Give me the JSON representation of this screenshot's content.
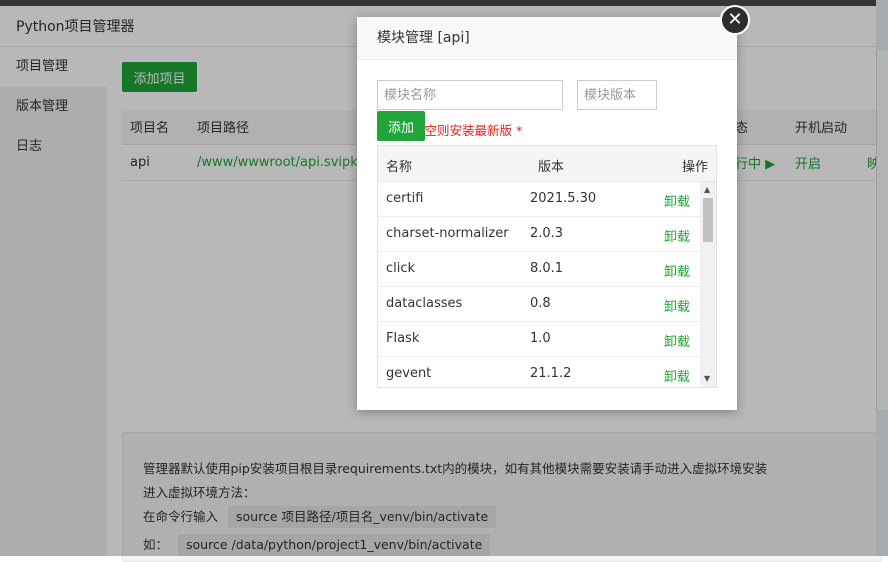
{
  "app": {
    "title": "Python项目管理器"
  },
  "sidebar": {
    "items": [
      {
        "label": "项目管理"
      },
      {
        "label": "版本管理"
      },
      {
        "label": "日志"
      }
    ]
  },
  "toolbar": {
    "add_project": "添加项目"
  },
  "project_table": {
    "headers": [
      "项目名",
      "项目路径",
      "",
      "态",
      "开机启动",
      ""
    ],
    "rows": [
      {
        "name": "api",
        "path": "/www/wwwroot/api.svipki",
        "status": "行中 ▶",
        "autostart": "开启",
        "extra": "映"
      }
    ]
  },
  "info": {
    "line1": "管理器默认使用pip安装项目根目录requirements.txt内的模块，如有其他模块需要安装请手动进入虚拟环境安装",
    "line2": "进入虚拟环境方法：",
    "line3_label": "在命令行输入",
    "line3_code": "source 项目路径/项目名_venv/bin/activate",
    "line4_label": "如：",
    "line4_code": "source /data/python/project1_venv/bin/activate"
  },
  "modal": {
    "title": "模块管理 [api]",
    "close_glyph": "✕",
    "name_placeholder": "模块名称",
    "version_placeholder": "模块版本",
    "add_label": "添加",
    "hint": "版本留空则安装最新版 *",
    "headers": {
      "name": "名称",
      "version": "版本",
      "action": "操作"
    },
    "modules": [
      {
        "name": "certifi",
        "version": "2021.5.30",
        "action": "卸载"
      },
      {
        "name": "charset-normalizer",
        "version": "2.0.3",
        "action": "卸载"
      },
      {
        "name": "click",
        "version": "8.0.1",
        "action": "卸载"
      },
      {
        "name": "dataclasses",
        "version": "0.8",
        "action": "卸载"
      },
      {
        "name": "Flask",
        "version": "1.0",
        "action": "卸载"
      },
      {
        "name": "gevent",
        "version": "21.1.2",
        "action": "卸载"
      }
    ]
  },
  "colors": {
    "accent": "#20a53a",
    "danger": "#e01e1e"
  }
}
